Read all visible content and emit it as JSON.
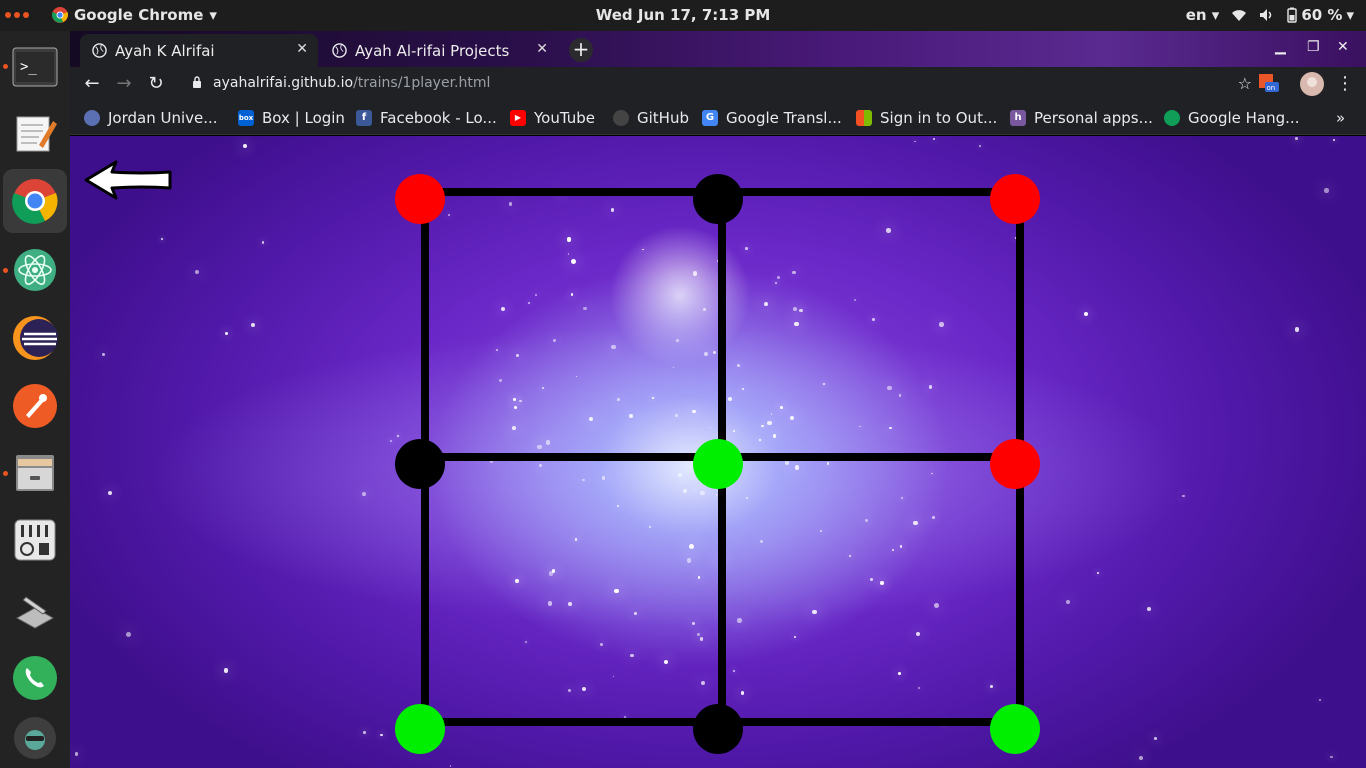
{
  "topbar": {
    "app_name": "Google Chrome",
    "clock": "Wed Jun 17,  7:13 PM",
    "language": "en",
    "battery": "60 %"
  },
  "dock": {
    "items": [
      {
        "name": "terminal-icon"
      },
      {
        "name": "text-editor-icon"
      },
      {
        "name": "chrome-icon"
      },
      {
        "name": "atom-icon"
      },
      {
        "name": "eclipse-icon"
      },
      {
        "name": "postman-icon"
      },
      {
        "name": "file-cabinet-icon"
      },
      {
        "name": "settings-mixer-icon"
      },
      {
        "name": "system-tools-icon"
      },
      {
        "name": "whatsapp-phone-icon"
      },
      {
        "name": "user-avatar-icon"
      }
    ]
  },
  "tabs": [
    {
      "title": "Ayah K Alrifai",
      "active": true
    },
    {
      "title": "Ayah Al-rifai Projects",
      "active": false
    }
  ],
  "address_bar": {
    "host": "ayahalrifai.github.io",
    "path": "/trains/1player.html"
  },
  "bookmarks": [
    {
      "label": "Jordan Unive...",
      "icon": "university-icon",
      "color": "#5b6fb3"
    },
    {
      "label": "Box | Login",
      "icon": "box-icon",
      "color": "#0061d5"
    },
    {
      "label": "Facebook - Lo...",
      "icon": "facebook-icon",
      "color": "#3b5998"
    },
    {
      "label": "YouTube",
      "icon": "youtube-icon",
      "color": "#ff0000"
    },
    {
      "label": "GitHub",
      "icon": "github-icon",
      "color": "#444444"
    },
    {
      "label": "Google Transl...",
      "icon": "google-translate-icon",
      "color": "#4285f4"
    },
    {
      "label": "Sign in to Out...",
      "icon": "microsoft-icon",
      "color": "#f25022"
    },
    {
      "label": "Personal apps...",
      "icon": "heroku-icon",
      "color": "#79589f"
    },
    {
      "label": "Google Hang...",
      "icon": "hangouts-icon",
      "color": "#0f9d58"
    }
  ],
  "game": {
    "colors": {
      "red": "#ff0000",
      "green": "#00ee00",
      "empty": "#000000"
    },
    "nodes": [
      {
        "id": "top-left",
        "state": "red"
      },
      {
        "id": "top-middle",
        "state": "empty"
      },
      {
        "id": "top-right",
        "state": "red"
      },
      {
        "id": "middle-left",
        "state": "empty"
      },
      {
        "id": "center",
        "state": "green"
      },
      {
        "id": "middle-right",
        "state": "red"
      },
      {
        "id": "bottom-left",
        "state": "green"
      },
      {
        "id": "bottom-middle",
        "state": "empty"
      },
      {
        "id": "bottom-right",
        "state": "green"
      }
    ]
  }
}
